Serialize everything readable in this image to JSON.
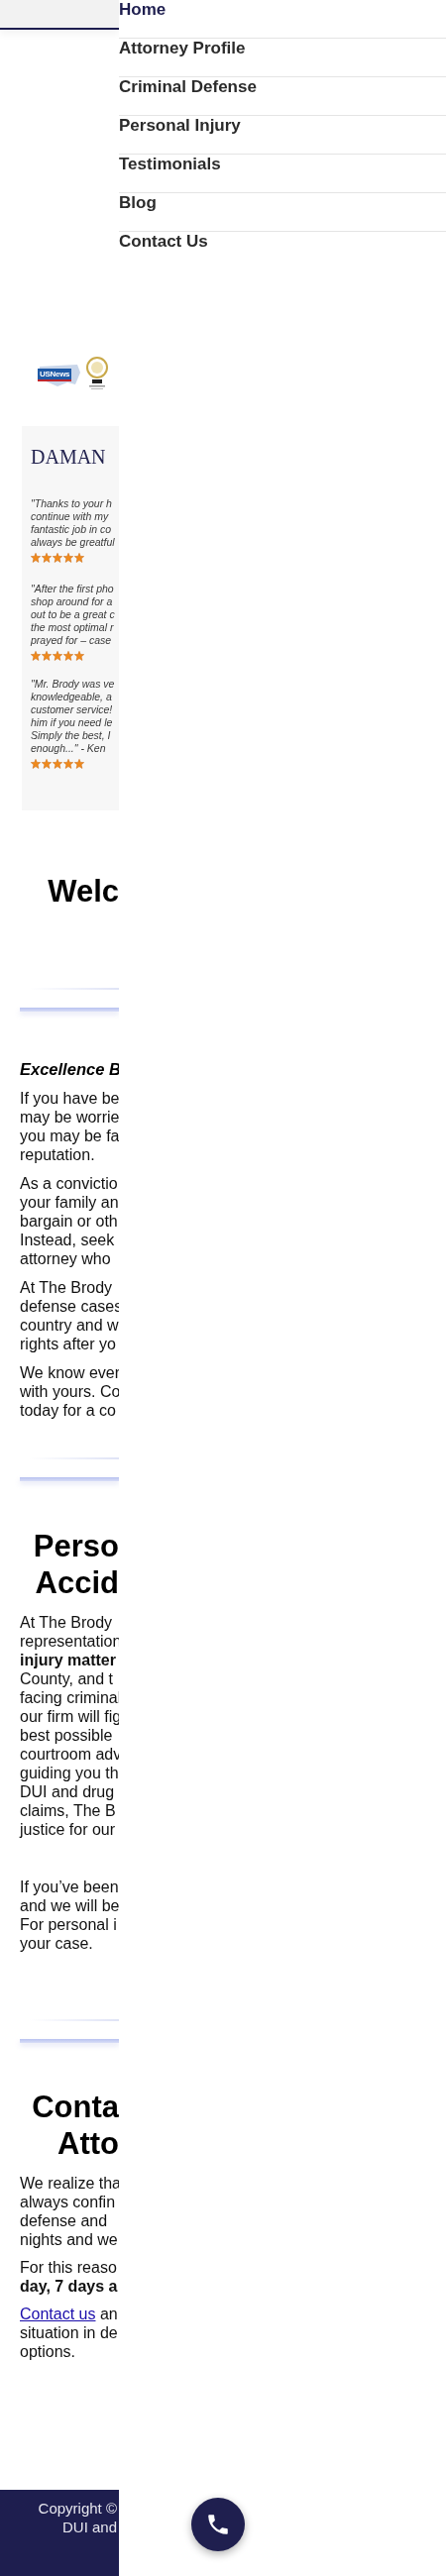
{
  "menu": {
    "items": [
      {
        "label": "Home",
        "selected": true
      },
      {
        "label": "Attorney Profile",
        "selected": false
      },
      {
        "label": "Criminal Defense",
        "selected": false
      },
      {
        "label": "Personal Injury",
        "selected": false
      },
      {
        "label": "Testimonials",
        "selected": false
      },
      {
        "label": "Blog",
        "selected": false
      },
      {
        "label": "Contact Us",
        "selected": false
      }
    ]
  },
  "badges": {
    "logo_text": "USNews"
  },
  "testimonials": {
    "title": "DAMAN",
    "quotes": [
      {
        "lines": [
          "\"Thanks to your h",
          "continue with my",
          "fantastic job in co",
          "always be greatful"
        ],
        "stars": 5
      },
      {
        "lines": [
          "\"After the first pho",
          "shop around for a",
          "out to be a great c",
          "the most optimal r",
          "prayed for – case"
        ],
        "stars": 5
      },
      {
        "lines": [
          "\"Mr. Brody was ve",
          "knowledgeable, a",
          "customer service!",
          "him if you need le",
          "Simply the best, I",
          "enough...\"   - Ken"
        ],
        "stars": 5
      }
    ]
  },
  "sections": [
    {
      "heading": [
        "Welc"
      ],
      "subheading": "Excellence B",
      "paragraphs": [
        {
          "lines": [
            "If you have be",
            "may be worrie",
            "you may be fa",
            "reputation."
          ]
        },
        {
          "lines": [
            "As a convictio",
            "your family an",
            "bargain or oth",
            "Instead, seek",
            "attorney who"
          ]
        },
        {
          "lines": [
            "At The Brody",
            "defense cases",
            "country and w",
            "rights after yo"
          ]
        },
        {
          "lines": [
            "We know ever",
            "with yours. Co",
            "today for a co"
          ]
        }
      ]
    },
    {
      "heading": [
        "Perso",
        "Accid"
      ],
      "paragraphs": [
        {
          "lines": [
            "At The Brody",
            "representation",
            "**injury matter**",
            "County, and t",
            "facing criminal",
            "our firm will fig",
            "best possible",
            "courtroom adv",
            "guiding you th",
            "DUI and drug",
            "claims, The B",
            "justice for our"
          ]
        },
        {
          "lines": [
            "If you’ve been",
            "and we will be",
            "For personal i",
            "your case."
          ]
        }
      ]
    },
    {
      "heading": [
        "Conta",
        "Atto"
      ],
      "paragraphs": [
        {
          "lines": [
            "We realize tha",
            "always confin",
            "defense and",
            "nights and we"
          ]
        },
        {
          "lines": [
            "For this reaso",
            "**day, 7 days a**"
          ]
        },
        {
          "link": "Contact us",
          "lines": [
            " an",
            "situation in de",
            "options."
          ]
        }
      ]
    }
  ],
  "footer": {
    "lines": [
      "Copyright ©",
      "DUI and"
    ]
  }
}
